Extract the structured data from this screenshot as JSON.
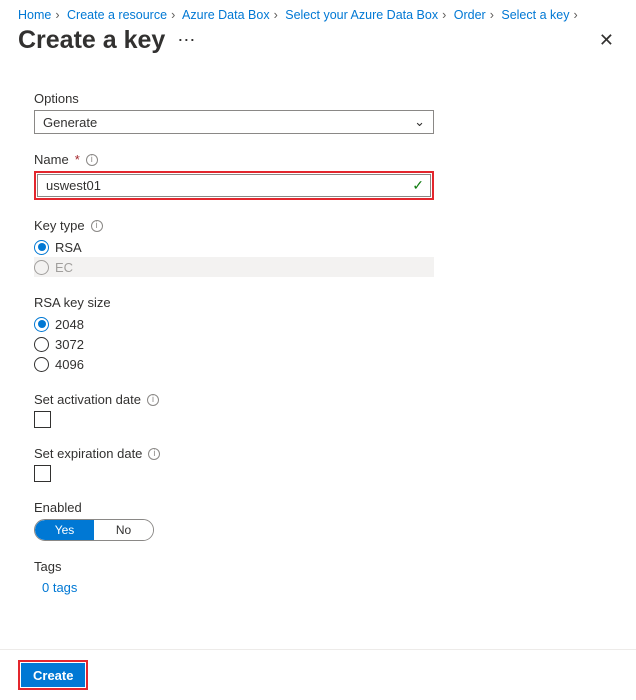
{
  "breadcrumb": [
    "Home",
    "Create a resource",
    "Azure Data Box",
    "Select your Azure Data Box",
    "Order",
    "Select a key"
  ],
  "header": {
    "title": "Create a key"
  },
  "options": {
    "label": "Options",
    "value": "Generate"
  },
  "name": {
    "label": "Name",
    "required": "*",
    "value": "uswest01"
  },
  "keytype": {
    "label": "Key type",
    "items": [
      {
        "label": "RSA",
        "selected": true,
        "disabled": false
      },
      {
        "label": "EC",
        "selected": false,
        "disabled": true
      }
    ]
  },
  "keysize": {
    "label": "RSA key size",
    "items": [
      {
        "label": "2048",
        "selected": true
      },
      {
        "label": "3072",
        "selected": false
      },
      {
        "label": "4096",
        "selected": false
      }
    ]
  },
  "activation": {
    "label": "Set activation date"
  },
  "expiration": {
    "label": "Set expiration date"
  },
  "enabled": {
    "label": "Enabled",
    "yes": "Yes",
    "no": "No"
  },
  "tags": {
    "label": "Tags",
    "link": "0 tags"
  },
  "footer": {
    "create": "Create"
  }
}
